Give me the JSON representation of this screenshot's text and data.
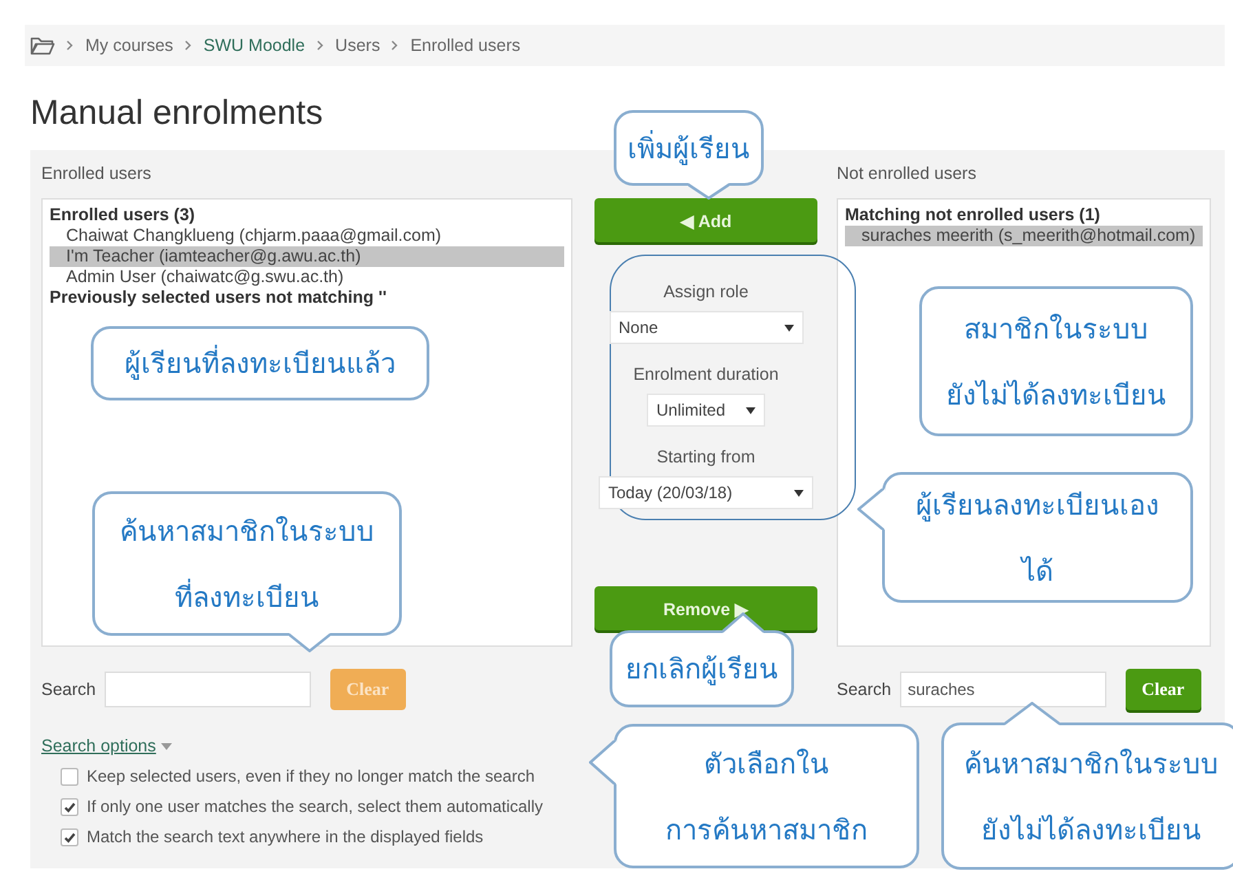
{
  "breadcrumb": [
    {
      "label": "My courses",
      "link": false
    },
    {
      "label": "SWU Moodle",
      "link": true
    },
    {
      "label": "Users",
      "link": false
    },
    {
      "label": "Enrolled users",
      "link": false
    }
  ],
  "page_title": "Manual enrolments",
  "enrolled": {
    "label": "Enrolled users",
    "groups": [
      {
        "heading": "Enrolled users (3)",
        "users": [
          {
            "text": "Chaiwat Changklueng (chjarm.paaa@gmail.com)",
            "selected": false
          },
          {
            "text": "I'm Teacher (iamteacher@g.awu.ac.th)",
            "selected": true
          },
          {
            "text": "Admin User (chaiwatc@g.swu.ac.th)",
            "selected": false
          }
        ]
      },
      {
        "heading": "Previously selected users not matching ''"
      }
    ],
    "search": {
      "label": "Search"
    },
    "clear": {
      "label": "Clear",
      "disabled": true
    }
  },
  "actions": {
    "add": "◀ Add",
    "remove": "Remove ▶",
    "fields": [
      {
        "label": "Assign role",
        "value": "None",
        "kind": "wide"
      },
      {
        "label": "Enrolment duration",
        "value": "Unlimited",
        "kind": "narrow"
      },
      {
        "label": "Starting from",
        "value": "Today (20/03/18)",
        "kind": "full"
      }
    ]
  },
  "not_enrolled": {
    "label": "Not enrolled users",
    "groups": [
      {
        "heading": "Matching not enrolled users (1)",
        "users": [
          {
            "text": "suraches meerith (s_meerith@hotmail.com)",
            "selected": true
          }
        ]
      }
    ],
    "search": {
      "label": "Search",
      "value": "suraches"
    },
    "clear": {
      "label": "Clear",
      "disabled": false
    }
  },
  "search_options": {
    "label": "Search options",
    "options": [
      {
        "label": "Keep selected users, even if they no longer match the search",
        "checked": false
      },
      {
        "label": "If only one user matches the search, select them automatically",
        "checked": true
      },
      {
        "label": "Match the search text anywhere in the displayed fields",
        "checked": true
      }
    ]
  },
  "callouts": [
    {
      "text": "เพิ่มผู้เรียน",
      "kind": "down"
    },
    {
      "text": "ผู้เรียนที่ลงทะเบียนแล้ว",
      "kind": "plain"
    },
    {
      "text": "ค้นหาสมาชิกในระบบ\nที่ลงทะเบียน",
      "kind": "down"
    },
    {
      "text": "สมาชิกในระบบ\nยังไม่ได้ลงทะเบียน",
      "kind": "plain"
    },
    {
      "text": "ผู้เรียนลงทะเบียนเอง\nได้",
      "kind": "left"
    },
    {
      "text": "ยกเลิกผู้เรียน",
      "kind": "up"
    },
    {
      "text": "ตัวเลือกใน\nการค้นหาสมาชิก",
      "kind": "left"
    },
    {
      "text": "ค้นหาสมาชิกในระบบ\nยังไม่ได้ลงทะเบียน",
      "kind": "up"
    }
  ]
}
